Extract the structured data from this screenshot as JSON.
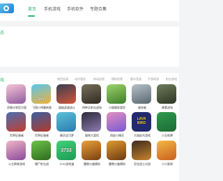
{
  "nav": {
    "items": [
      "首页",
      "手机游戏",
      "手机软件",
      "专题合集"
    ]
  },
  "banner": {
    "label": "态"
  },
  "section": {
    "label": "戏",
    "tabs": [
      "角色扮演",
      "动作冒险",
      "休闲益智",
      "模拟经营",
      "赛车竞速",
      "手游网游",
      "射击游戏"
    ]
  },
  "games": [
    {
      "name": "奇章计划官方版",
      "badge": ""
    },
    {
      "name": "飞翔小鸡最新版",
      "badge": "SKY"
    },
    {
      "name": "超级英雄战斗",
      "badge": ""
    },
    {
      "name": "特种兵射击战场",
      "badge": ""
    },
    {
      "name": "小猴跳跃冒险",
      "badge": ""
    },
    {
      "name": "维修者",
      "badge": ""
    },
    {
      "name": "像素战场",
      "badge": ""
    },
    {
      "name": "世界征服者",
      "badge": ""
    },
    {
      "name": "世界征服者",
      "badge": ""
    },
    {
      "name": "精灵宝可梦",
      "badge": ""
    },
    {
      "name": "猫咪大冒险",
      "badge": ""
    },
    {
      "name": "俏皮小精灵",
      "badge": ""
    },
    {
      "name": "大熔岩鸟游戏",
      "badge": "LAVA BIRD"
    },
    {
      "name": "小丑纸牌",
      "badge": ""
    },
    {
      "name": "公主换装游戏",
      "badge": ""
    },
    {
      "name": "僵尸射击战",
      "badge": ""
    },
    {
      "name": "3733游戏盒",
      "badge": "3733"
    },
    {
      "name": "魔兽沙盒模拟",
      "badge": ""
    },
    {
      "name": "魔兽沙盒模拟",
      "badge": ""
    },
    {
      "name": "恐龙战士对战",
      "badge": ""
    },
    {
      "name": "小小星球",
      "badge": ""
    }
  ],
  "colors": {
    "accent": "#2bb673",
    "page_bg": "#f3f4f6"
  }
}
